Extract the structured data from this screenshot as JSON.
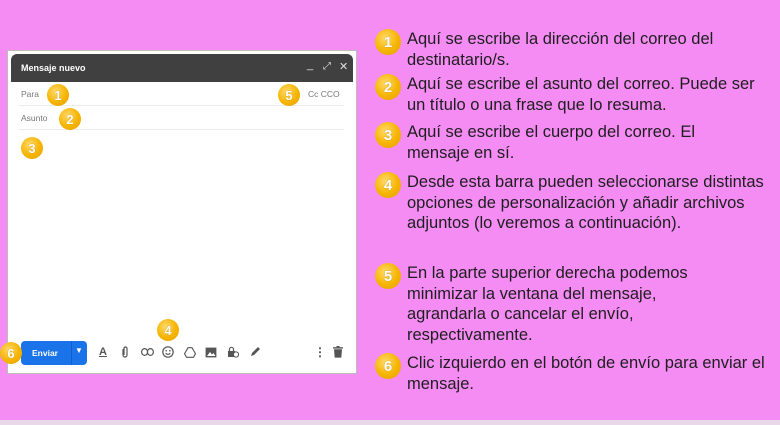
{
  "compose": {
    "title": "Mensaje nuevo",
    "to_placeholder": "Para",
    "subject_placeholder": "Asunto",
    "cc_label": "Cc CCO",
    "send_label": "Enviar",
    "window_controls": [
      "minimize-icon",
      "expand-icon",
      "close-icon"
    ],
    "toolbar_icons": [
      "format-text-icon",
      "attach-icon",
      "link-icon",
      "emoji-icon",
      "drive-icon",
      "image-icon",
      "lock-clock-icon",
      "pen-icon",
      "more-vert-icon",
      "trash-icon"
    ]
  },
  "badges": {
    "one": "1",
    "two": "2",
    "three": "3",
    "four": "4",
    "five": "5",
    "six": "6"
  },
  "explanations": [
    {
      "number": "1",
      "text": "Aquí se escribe la dirección del correo del destinatario/s."
    },
    {
      "number": "2",
      "text": "Aquí se escribe el asunto del correo. Puede ser un título o una frase que lo resuma."
    },
    {
      "number": "3",
      "text": "Aquí se escribe el cuerpo del correo. El mensaje en sí."
    },
    {
      "number": "4",
      "text": "Desde esta barra pueden seleccionarse distintas opciones de personalización y añadir archivos adjuntos (lo veremos a continuación)."
    },
    {
      "number": "5",
      "text": "En la parte superior derecha podemos minimizar la ventana del mensaje, agrandarla o cancelar el envío, respectivamente."
    },
    {
      "number": "6",
      "text": "Clic izquierdo en el botón de envío para enviar el mensaje."
    }
  ],
  "colors": {
    "background": "#f48cf4",
    "title_bar": "#404040",
    "send_button": "#1a73e8",
    "badge": "#f6b400"
  }
}
